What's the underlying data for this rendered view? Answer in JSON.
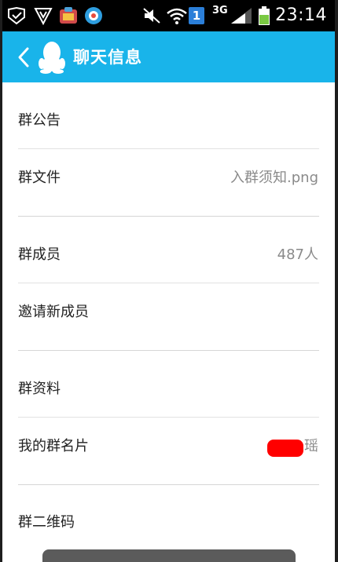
{
  "status_bar": {
    "time": "23:14",
    "network": "3G",
    "notification_count": "1",
    "battery_color": "#7ac943"
  },
  "header": {
    "title": "聊天信息",
    "accent_color": "#19b4ea"
  },
  "settings": {
    "announcement": {
      "label": "群公告"
    },
    "files": {
      "label": "群文件",
      "value": "入群须知.png"
    },
    "members": {
      "label": "群成员",
      "value": "487人"
    },
    "invite": {
      "label": "邀请新成员"
    },
    "profile": {
      "label": "群资料"
    },
    "my_card": {
      "label": "我的群名片",
      "value": "瑶"
    },
    "qr_code": {
      "label": "群二维码"
    }
  }
}
